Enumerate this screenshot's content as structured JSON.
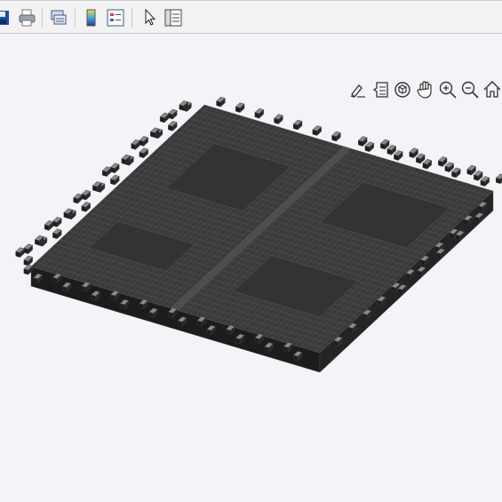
{
  "window": {
    "background": "#f5f3f7"
  },
  "toolbar": {
    "buttons": [
      {
        "name": "save-icon",
        "interactable": true
      },
      {
        "name": "print-icon",
        "interactable": true
      },
      {
        "name": "link-plot-icon",
        "interactable": true
      },
      {
        "name": "insert-colorbar-icon",
        "interactable": true
      },
      {
        "name": "insert-legend-icon",
        "interactable": true
      },
      {
        "name": "edit-plot-icon",
        "interactable": true
      },
      {
        "name": "property-inspector-icon",
        "interactable": true
      }
    ]
  },
  "axes_toolbar": {
    "tools": [
      "brush-icon",
      "data-tips-icon",
      "rotate-3d-icon",
      "pan-icon",
      "zoom-in-icon",
      "zoom-out-icon",
      "restore-view-icon"
    ]
  },
  "figure": {
    "content": "3d-voxel-mesh",
    "colors": {
      "voxel_face": "#2a2a2a",
      "voxel_edge": "#5a5a5a",
      "voxel_top": "#3a3a3a"
    }
  }
}
